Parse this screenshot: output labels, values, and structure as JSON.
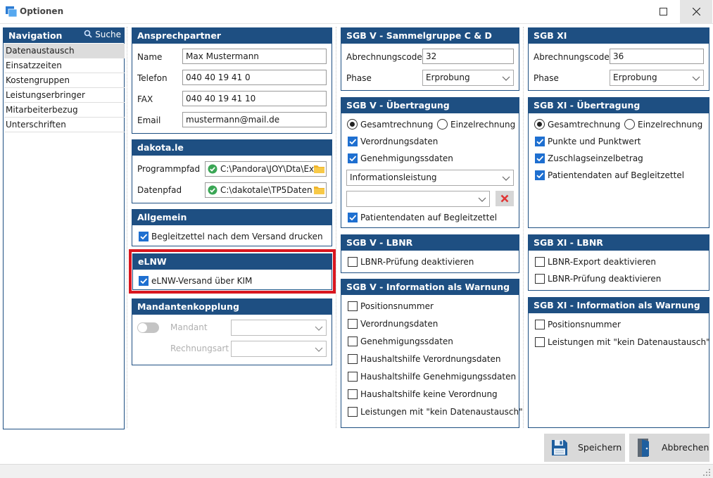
{
  "window": {
    "title": "Optionen"
  },
  "nav": {
    "header": "Navigation",
    "search_label": "Suche",
    "items": [
      "Datenaustausch",
      "Einsatzzeiten",
      "Kostengruppen",
      "Leistungserbringer",
      "Mitarbeiterbezug",
      "Unterschriften"
    ],
    "selected": "Datenaustausch"
  },
  "contact": {
    "header": "Ansprechpartner",
    "name_label": "Name",
    "name_value": "Max Mustermann",
    "phone_label": "Telefon",
    "phone_value": "040 40 19 41 0",
    "fax_label": "FAX",
    "fax_value": "040 40 19 41 10",
    "email_label": "Email",
    "email_value": "mustermann@mail.de"
  },
  "dakota": {
    "header": "dakota.le",
    "program_label": "Programmpfad",
    "program_value": "C:\\Pandora\\JOY\\Dta\\Ex",
    "data_label": "Datenpfad",
    "data_value": "C:\\dakotale\\TP5Daten"
  },
  "general": {
    "header": "Allgemein",
    "print_label": "Begleitzettel nach dem Versand drucken",
    "print_checked": true
  },
  "elnw": {
    "header": "eLNW",
    "kim_label": "eLNW-Versand über KIM",
    "kim_checked": true,
    "highlight_color": "#d9161f"
  },
  "mandant": {
    "header": "Mandantenkopplung",
    "mandant_label": "Mandant",
    "rechnungsart_label": "Rechnungsart",
    "toggle_on": false
  },
  "sgbv_group": {
    "header": "SGB V - Sammelgruppe C & D",
    "code_label": "Abrechnungscode",
    "code_value": "32",
    "phase_label": "Phase",
    "phase_value": "Erprobung"
  },
  "sgbv_transfer": {
    "header": "SGB V - Übertragung",
    "radio_total": "Gesamtrechnung",
    "radio_single": "Einzelrechnung",
    "selected_radio": "Gesamtrechnung",
    "cb_prescription": "Verordnungsdaten",
    "cb_approval": "Genehmigungssdaten",
    "info_select": "Informationsleistung",
    "cb_patient": "Patientendaten auf Begleitzettel"
  },
  "sgbv_lbnr": {
    "header": "SGB V - LBNR",
    "cb_label": "LBNR-Prüfung deaktivieren",
    "checked": false
  },
  "sgbv_warn": {
    "header": "SGB V - Information als Warnung",
    "items": [
      "Positionsnummer",
      "Verordnungsdaten",
      "Genehmigungssdaten",
      "Haushaltshilfe Verordnungsdaten",
      "Haushaltshilfe Genehmigungssdaten",
      "Haushaltshilfe keine Verordnung",
      "Leistungen mit \"kein Datenaustausch\""
    ]
  },
  "sgbxi": {
    "header": "SGB XI",
    "code_label": "Abrechnungscode",
    "code_value": "36",
    "phase_label": "Phase",
    "phase_value": "Erprobung"
  },
  "sgbxi_transfer": {
    "header": "SGB XI - Übertragung",
    "radio_total": "Gesamtrechnung",
    "radio_single": "Einzelrechnung",
    "selected_radio": "Gesamtrechnung",
    "cb_points": "Punkte und Punktwert",
    "cb_surcharge": "Zuschlagseinzelbetrag",
    "cb_patient": "Patientendaten auf Begleitzettel"
  },
  "sgbxi_lbnr": {
    "header": "SGB XI - LBNR",
    "cb_export": "LBNR-Export deaktivieren",
    "cb_check": "LBNR-Prüfung deaktivieren"
  },
  "sgbxi_warn": {
    "header": "SGB XI - Information als Warnung",
    "items": [
      "Positionsnummer",
      "Leistungen mit \"kein Datenaustausch\""
    ]
  },
  "buttons": {
    "save": "Speichern",
    "cancel": "Abbrechen"
  },
  "colors": {
    "panel_header": "#1e4f82",
    "checkbox": "#1e6fd0",
    "highlight": "#d9161f",
    "button_bg": "#d9d9d9"
  }
}
